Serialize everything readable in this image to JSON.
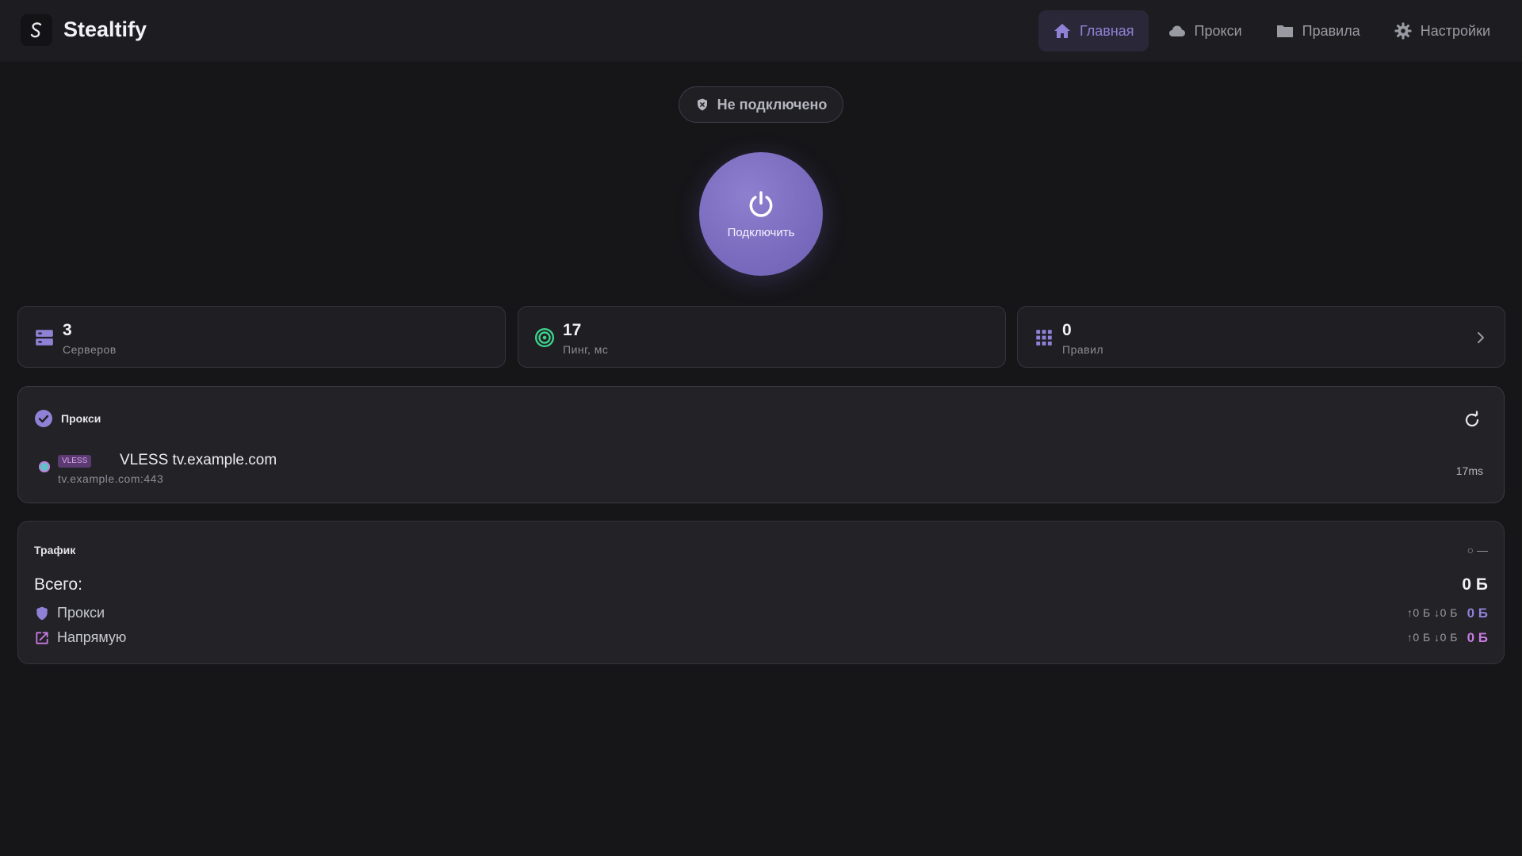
{
  "app": {
    "title": "Stealtify",
    "logo_letter": "S"
  },
  "nav": {
    "items": [
      {
        "label": "Главная",
        "icon": "home-icon",
        "active": true
      },
      {
        "label": "Прокси",
        "icon": "cloud-icon",
        "active": false
      },
      {
        "label": "Правила",
        "icon": "folder-icon",
        "active": false
      },
      {
        "label": "Настройки",
        "icon": "gear-icon",
        "active": false
      }
    ]
  },
  "status": {
    "text": "Не подключено",
    "icon": "shield-icon"
  },
  "power": {
    "label": "Подключить",
    "icon": "power-icon"
  },
  "stats": [
    {
      "value": "3",
      "caption": "Серверов",
      "icon": "server-icon"
    },
    {
      "value": "17",
      "caption": "Пинг, мс",
      "icon": "target-icon"
    },
    {
      "value": "0",
      "caption": "Правил",
      "icon": "grid-icon"
    }
  ],
  "proxy": {
    "title": "Прокси",
    "selected": {
      "badge": "VLESS",
      "name": "VLESS tv.example.com",
      "host": "tv.example.com:443",
      "ping": "17ms"
    }
  },
  "traffic": {
    "title": "Трафик",
    "toggle": "○ —",
    "total_label": "Всего:",
    "total_value": "0 Б",
    "rows": [
      {
        "label": "Прокси",
        "updown": "↑0 Б  ↓0 Б",
        "value": "0 Б",
        "color": "#8f82d6",
        "icon": "shield-icon"
      },
      {
        "label": "Напрямую",
        "updown": "↑0 Б  ↓0 Б",
        "value": "0 Б",
        "color": "#c77ae0",
        "icon": "external-link-icon"
      }
    ]
  },
  "colors": {
    "accent": "#8f82d6",
    "success": "#3fd18a",
    "background": "#161619"
  }
}
